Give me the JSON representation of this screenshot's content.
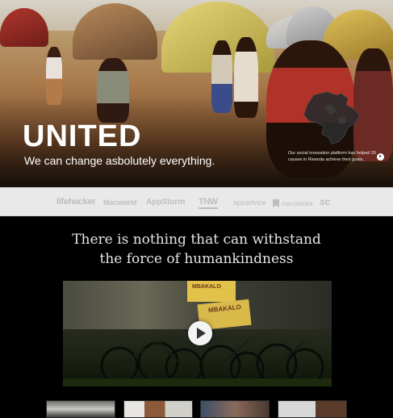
{
  "hero": {
    "title": "UNITED",
    "subtitle": "We can change asbolutely everything.",
    "note": "Our social innovation platform has helped 20 causes in Rwanda achieve their goals."
  },
  "press": {
    "logos": [
      "lifehacker",
      "Macworld",
      "AppStorm",
      "TNW",
      "appadvice",
      "macstories",
      "sc"
    ]
  },
  "tagline": {
    "line1": "There is nothing that can withstand",
    "line2": "the force of humankindness"
  },
  "video": {
    "sign1": "MBAKALO",
    "sign2": "MBAKALO"
  },
  "icons": {
    "next": "chevron-right-icon",
    "play": "play-icon",
    "map": "africa-map-icon"
  },
  "colors": {
    "background": "#000000",
    "press_bar": "#e9e9e9",
    "hero_text": "#ffffff"
  }
}
